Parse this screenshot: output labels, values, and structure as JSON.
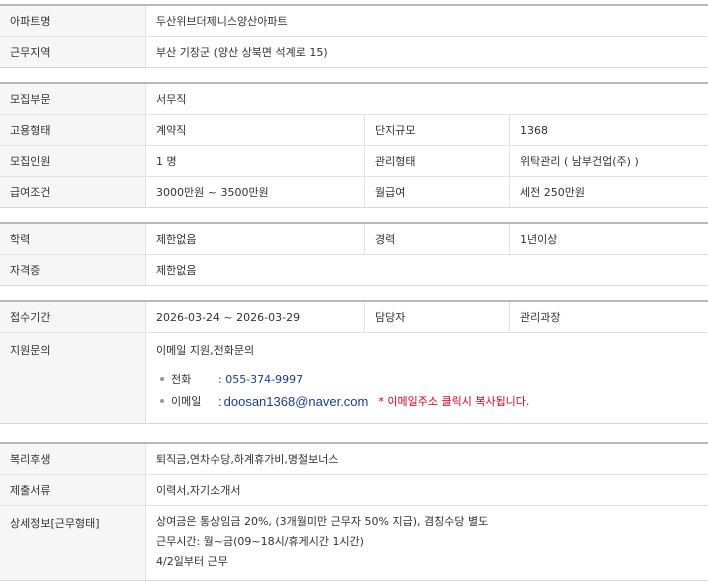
{
  "s1": {
    "apt_name_label": "아파트명",
    "apt_name_value": "두산위브더제니스양산아파트",
    "location_label": "근무지역",
    "location_value": "부산 기장군 (양산 상북면 석계로 15)"
  },
  "s2": {
    "dept_label": "모집부문",
    "dept_value": "서무직",
    "emp_type_label": "고용형태",
    "emp_type_value": "계약직",
    "complex_size_label": "단지규모",
    "complex_size_value": "1368",
    "headcount_label": "모집인원",
    "headcount_value": "1 명",
    "mgmt_type_label": "관리형태",
    "mgmt_type_value": "위탁관리 ( 남부건업(주) )",
    "salary_label": "급여조건",
    "salary_value": "3000만원 ~ 3500만원",
    "monthly_label": "월급여",
    "monthly_value": "세전 250만원"
  },
  "s3": {
    "edu_label": "학력",
    "edu_value": "제한없음",
    "career_label": "경력",
    "career_value": "1년이상",
    "cert_label": "자격증",
    "cert_value": "제한없음"
  },
  "s4": {
    "period_label": "접수기간",
    "period_value": "2026-03-24 ~ 2026-03-29",
    "manager_label": "담당자",
    "manager_value": "관리과장",
    "inquiry_label": "지원문의",
    "inquiry_value": "이메일 지원,전화문의",
    "phone_label": "전화",
    "phone_value": ": 055-374-9997",
    "email_label": "이메일",
    "email_sep": ":",
    "email_value": "doosan1368@naver.com",
    "email_note": "* 이메일주소 클릭시 복사됩니다."
  },
  "s5": {
    "welfare_label": "복리후생",
    "welfare_value": "퇴직금,연차수당,하계휴가비,명절보너스",
    "docs_label": "제출서류",
    "docs_value": "이력서,자기소개서",
    "detail_label": "상세정보[근무형태]",
    "detail_line1": "상여금은 통상임금 20%, (3개월미만 근무자 50% 지급), 겸칭수당 별도",
    "detail_line2": "근무시간: 월~금(09~18시/휴게시간 1시간)",
    "detail_line3": "4/2일부터 근무"
  }
}
